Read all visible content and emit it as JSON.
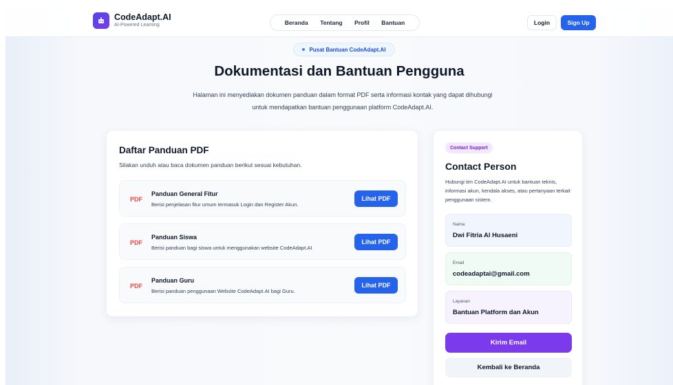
{
  "brand": {
    "name": "CodeAdapt.AI",
    "tagline": "AI-Powered Learning"
  },
  "nav": {
    "items": [
      "Beranda",
      "Tentang",
      "Profil",
      "Bantuan"
    ]
  },
  "auth": {
    "login_label": "Login",
    "signup_label": "Sign Up"
  },
  "hero": {
    "badge": "Pusat Bantuan CodeAdapt.AI",
    "title": "Dokumentasi dan Bantuan Pengguna",
    "description": "Halaman ini menyediakan dokumen panduan dalam format PDF serta informasi kontak yang dapat dihubungi untuk mendapatkan bantuan penggunaan platform CodeAdapt.AI."
  },
  "guides": {
    "title": "Daftar Panduan PDF",
    "subtitle": "Silakan unduh atau baca dokumen panduan berikut sesuai kebutuhan.",
    "items": [
      {
        "icon": "PDF",
        "title": "Panduan General Fitur",
        "description": "Berisi penjelasan fitur umum termasuk Login dan Register Akun.",
        "button": "Lihat PDF"
      },
      {
        "icon": "PDF",
        "title": "Panduan Siswa",
        "description": "Berisi panduan bagi siswa untuk menggunakan website CodeAdapt.AI",
        "button": "Lihat PDF"
      },
      {
        "icon": "PDF",
        "title": "Panduan Guru",
        "description": "Berisi panduan penggunaan Website CodeAdapt.AI bagi Guru.",
        "button": "Lihat PDF"
      }
    ]
  },
  "contact": {
    "badge": "Contact Support",
    "title": "Contact Person",
    "description": "Hubungi tim CodeAdapt.AI untuk bantuan teknis, informasi akun, kendala akses, atau pertanyaan terkait penggunaan sistem.",
    "fields": [
      {
        "label": "Nama",
        "value": "Dwi Fitria Al Husaeni",
        "bg": "#f1f5fd",
        "border": "#e7edf9"
      },
      {
        "label": "Email",
        "value": "codeadaptai@gmail.com",
        "bg": "#f0fbf5",
        "border": "#e2f5ea"
      },
      {
        "label": "Layanan",
        "value": "Bantuan Platform dan Akun",
        "bg": "#f6f3fe",
        "border": "#ece6fb"
      }
    ],
    "email_button": "Kirim Email",
    "home_button": "Kembali ke Beranda"
  },
  "colors": {
    "primary": "#2563eb",
    "accent": "#7c3aed",
    "pdf": "#ef4444"
  }
}
